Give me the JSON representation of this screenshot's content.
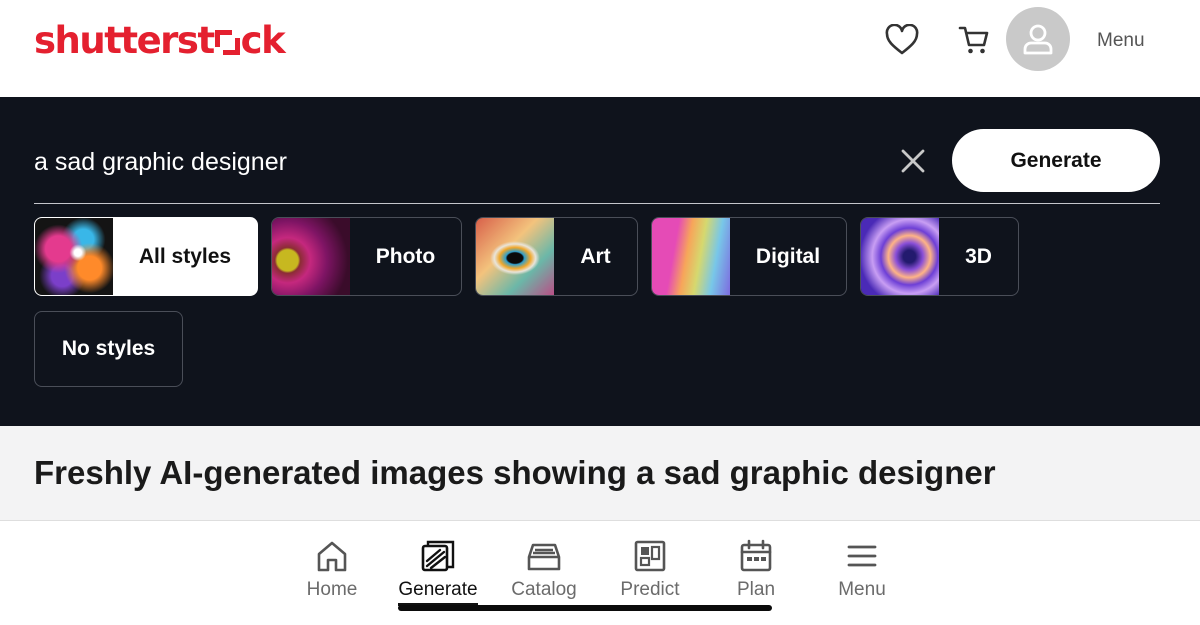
{
  "header": {
    "logo_text_a": "shutterst",
    "logo_text_b": "ck",
    "menu_label": "Menu",
    "brand_color": "#e4202f",
    "icons": [
      "heart-icon",
      "cart-icon",
      "user-icon"
    ]
  },
  "search": {
    "query": "a sad graphic designer",
    "generate_label": "Generate",
    "clear_icon": "close-icon"
  },
  "styles": [
    {
      "label": "All styles",
      "selected": true
    },
    {
      "label": "Photo",
      "selected": false
    },
    {
      "label": "Art",
      "selected": false
    },
    {
      "label": "Digital",
      "selected": false
    },
    {
      "label": "3D",
      "selected": false
    },
    {
      "label": "No styles",
      "selected": false
    }
  ],
  "section": {
    "title": "Freshly AI-generated images showing a sad graphic designer"
  },
  "bottom_nav": [
    {
      "label": "Home",
      "icon": "home-icon",
      "active": false
    },
    {
      "label": "Generate",
      "icon": "generate-icon",
      "active": true
    },
    {
      "label": "Catalog",
      "icon": "catalog-icon",
      "active": false
    },
    {
      "label": "Predict",
      "icon": "predict-icon",
      "active": false
    },
    {
      "label": "Plan",
      "icon": "calendar-icon",
      "active": false
    },
    {
      "label": "Menu",
      "icon": "hamburger-icon",
      "active": false
    }
  ]
}
